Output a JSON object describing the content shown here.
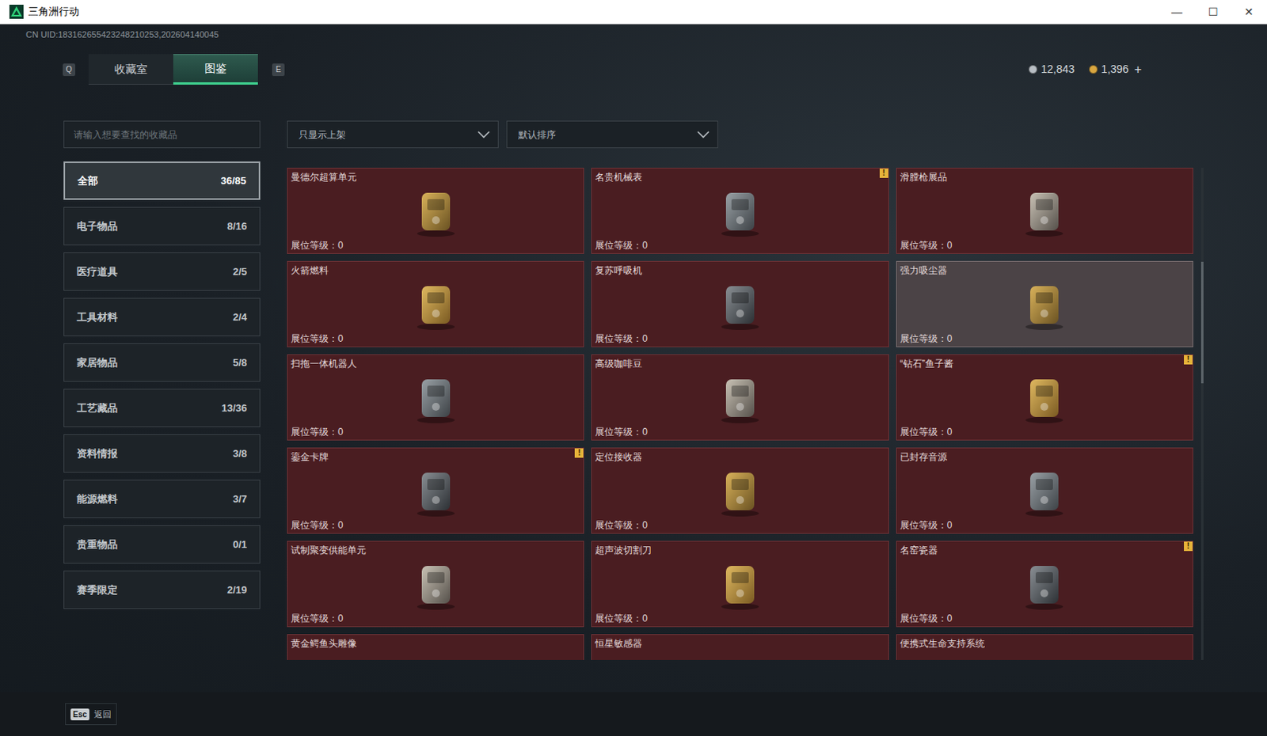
{
  "window": {
    "title": "三角洲行动",
    "controls": [
      "—",
      "☐",
      "✕"
    ]
  },
  "uid": "CN UID:183162655423248210253,202604140045",
  "tabs": {
    "prev_key": "Q",
    "next_key": "E",
    "items": [
      {
        "label": "收藏室",
        "selected": false
      },
      {
        "label": "图鉴",
        "selected": true
      }
    ]
  },
  "currency": [
    {
      "value": "12,843",
      "plus": "",
      "color": "#b8bec4"
    },
    {
      "value": "1,396",
      "plus": "+",
      "color": "#d8a640"
    }
  ],
  "search": {
    "placeholder": "请输入想要查找的收藏品"
  },
  "filters": [
    "只显示上架",
    "默认排序"
  ],
  "sidebar": {
    "items": [
      {
        "label": "全部",
        "count": "36/85",
        "selected": true
      },
      {
        "label": "电子物品",
        "count": "8/16",
        "selected": false
      },
      {
        "label": "医疗道具",
        "count": "2/5",
        "selected": false
      },
      {
        "label": "工具材料",
        "count": "2/4",
        "selected": false
      },
      {
        "label": "家居物品",
        "count": "5/8",
        "selected": false
      },
      {
        "label": "工艺藏品",
        "count": "13/36",
        "selected": false
      },
      {
        "label": "资料情报",
        "count": "3/8",
        "selected": false
      },
      {
        "label": "能源燃料",
        "count": "3/7",
        "selected": false
      },
      {
        "label": "贵重物品",
        "count": "0/1",
        "selected": false
      },
      {
        "label": "赛季限定",
        "count": "2/19",
        "selected": false
      }
    ]
  },
  "items": [
    {
      "name": "曼德尔超算单元",
      "level": "展位等级：0",
      "badge": "",
      "highlighted": false
    },
    {
      "name": "名贵机械表",
      "level": "展位等级：0",
      "badge": "!",
      "highlighted": false
    },
    {
      "name": "滑膛枪展品",
      "level": "展位等级：0",
      "badge": "",
      "highlighted": false
    },
    {
      "name": "火箭燃料",
      "level": "展位等级：0",
      "badge": "",
      "highlighted": false
    },
    {
      "name": "复苏呼吸机",
      "level": "展位等级：0",
      "badge": "",
      "highlighted": false
    },
    {
      "name": "强力吸尘器",
      "level": "展位等级：0",
      "badge": "",
      "highlighted": true
    },
    {
      "name": "扫拖一体机器人",
      "level": "展位等级：0",
      "badge": "",
      "highlighted": false
    },
    {
      "name": "高级咖啡豆",
      "level": "展位等级：0",
      "badge": "",
      "highlighted": false
    },
    {
      "name": "“钻石”鱼子酱",
      "level": "展位等级：0",
      "badge": "!",
      "highlighted": false
    },
    {
      "name": "鎏金卡牌",
      "level": "展位等级：0",
      "badge": "!",
      "highlighted": false
    },
    {
      "name": "定位接收器",
      "level": "展位等级：0",
      "badge": "",
      "highlighted": false
    },
    {
      "name": "已封存音源",
      "level": "展位等级：0",
      "badge": "",
      "highlighted": false
    },
    {
      "name": "试制聚变供能单元",
      "level": "展位等级：0",
      "badge": "",
      "highlighted": false
    },
    {
      "name": "超声波切割刀",
      "level": "展位等级：0",
      "badge": "",
      "highlighted": false
    },
    {
      "name": "名窑瓷器",
      "level": "展位等级：0",
      "badge": "!",
      "highlighted": false
    },
    {
      "name": "黄金鳄鱼头雕像",
      "level": "",
      "badge": "",
      "highlighted": false
    },
    {
      "name": "恒星敏感器",
      "level": "",
      "badge": "",
      "highlighted": false
    },
    {
      "name": "便携式生命支持系统",
      "level": "",
      "badge": "",
      "highlighted": false
    }
  ],
  "footer": {
    "key": "Esc",
    "label": "返回"
  }
}
